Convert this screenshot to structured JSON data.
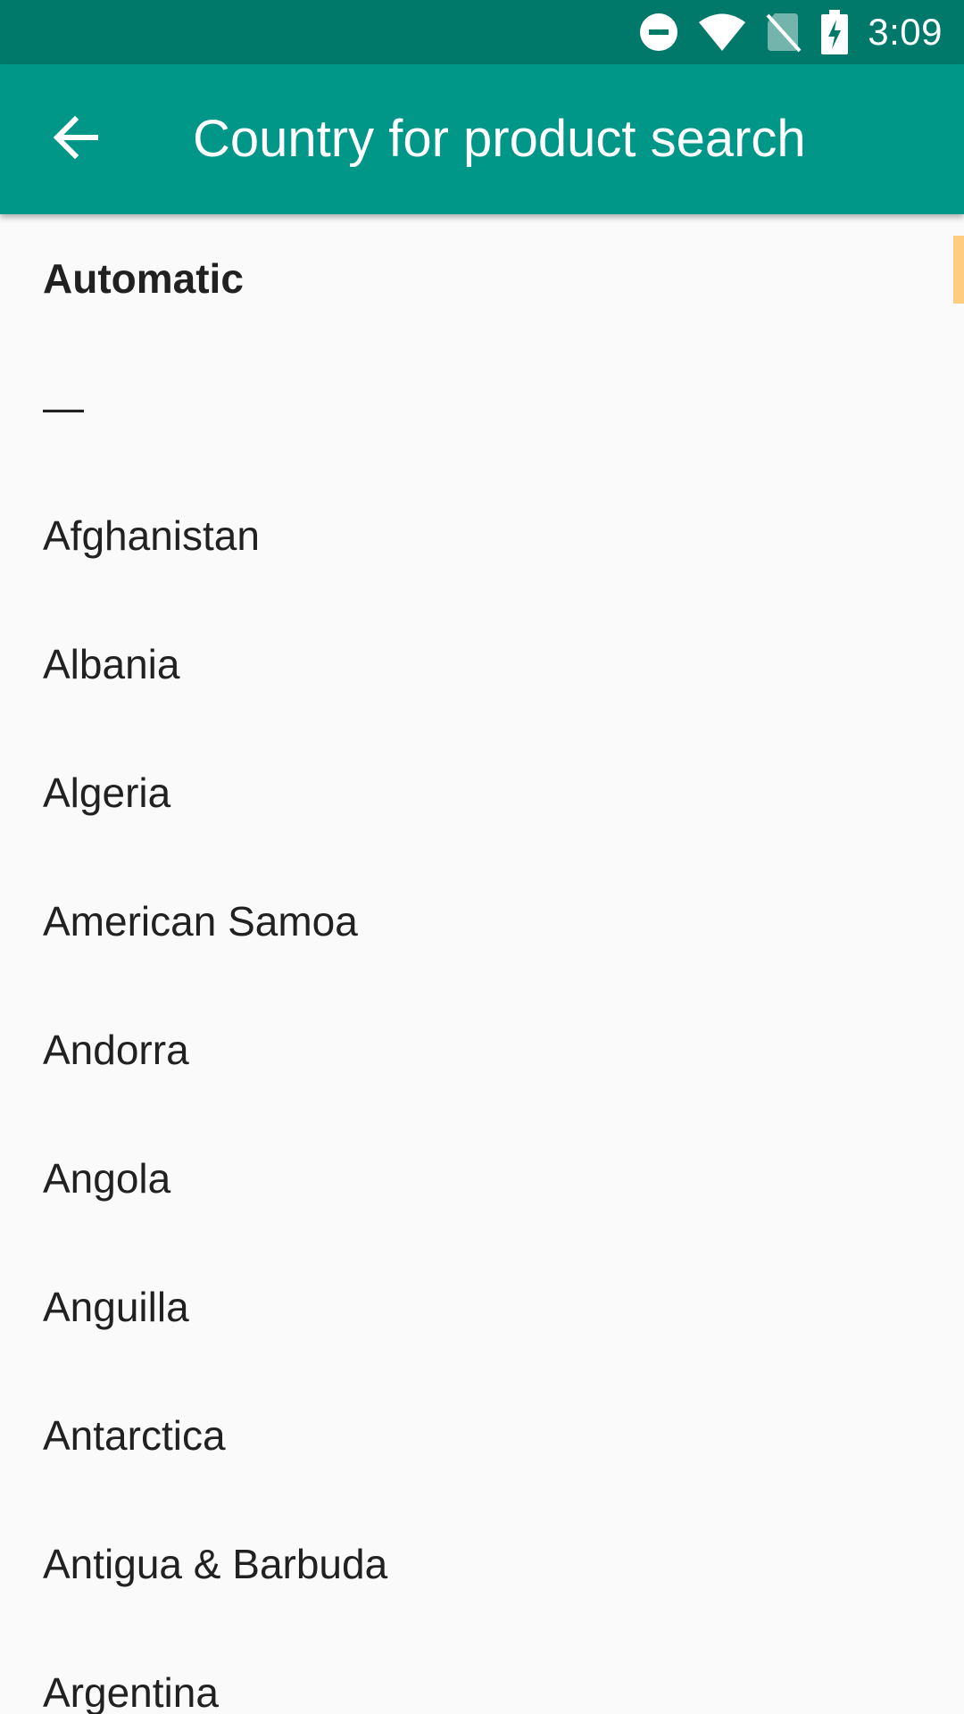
{
  "status_bar": {
    "time": "3:09",
    "icons": [
      "do-not-disturb-icon",
      "wifi-icon",
      "no-sim-icon",
      "battery-charging-icon"
    ]
  },
  "app_bar": {
    "title": "Country for product search",
    "back_icon": "arrow-back-icon"
  },
  "colors": {
    "status_bar": "#00796b",
    "app_bar": "#009688",
    "background": "#fafafa",
    "text": "#212121",
    "scroll_thumb": "#ffcc80"
  },
  "countries": {
    "items": [
      {
        "label": "Automatic"
      },
      {
        "label": "—"
      },
      {
        "label": "Afghanistan"
      },
      {
        "label": "Albania"
      },
      {
        "label": "Algeria"
      },
      {
        "label": "American Samoa"
      },
      {
        "label": "Andorra"
      },
      {
        "label": "Angola"
      },
      {
        "label": "Anguilla"
      },
      {
        "label": "Antarctica"
      },
      {
        "label": "Antigua & Barbuda"
      },
      {
        "label": "Argentina"
      }
    ]
  }
}
